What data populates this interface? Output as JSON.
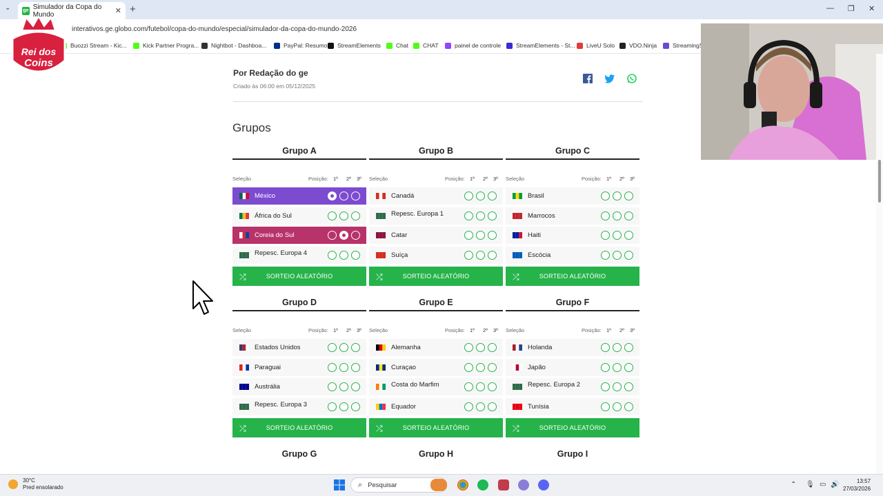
{
  "browser": {
    "tab_title": "Simulador da Copa do Mundo",
    "url": "interativos.ge.globo.com/futebol/copa-do-mundo/especial/simulador-da-copa-do-mundo-2026",
    "bookmarks": [
      {
        "label": "Buozzi Stream - Kic...",
        "color": "#53fc18"
      },
      {
        "label": "Kick Partner Progra...",
        "color": "#53fc18"
      },
      {
        "label": "Nightbot - Dashboa...",
        "color": "#333333"
      },
      {
        "label": "PayPal: Resumo",
        "color": "#003087"
      },
      {
        "label": "StreamElements",
        "color": "#111111"
      },
      {
        "label": "Chat",
        "color": "#53fc18"
      },
      {
        "label": "CHAT",
        "color": "#53fc18"
      },
      {
        "label": "painel de controle",
        "color": "#9146ff"
      },
      {
        "label": "StreamElements - St...",
        "color": "#3a2bd6"
      },
      {
        "label": "LiveU Solo",
        "color": "#e23b3b"
      },
      {
        "label": "VDO.Ninja",
        "color": "#222222"
      },
      {
        "label": "StreamingS",
        "color": "#6a4bd0"
      }
    ]
  },
  "logo": {
    "line1": "Rei dos",
    "line2": "Coins"
  },
  "article": {
    "byline": "Por Redação do ge",
    "created": "Criado às 06:00 em 05/12/2025",
    "section_title": "Grupos"
  },
  "labels": {
    "selecao": "Seleção",
    "posicao": "Posição:",
    "p1": "1º",
    "p2": "2º",
    "p3": "3º",
    "random_button": "SORTEIO ALEATÓRIO"
  },
  "groups": [
    {
      "name": "Grupo A",
      "teams": [
        {
          "name": "México",
          "flag": [
            "#006847",
            "#ffffff",
            "#ce1126"
          ],
          "selected": 1,
          "style": "selA"
        },
        {
          "name": "África do Sul",
          "flag": [
            "#007749",
            "#ffb81c",
            "#de3831"
          ],
          "selected": 0,
          "style": ""
        },
        {
          "name": "Coreia do Sul",
          "flag": [
            "#ffffff",
            "#cd2e3a",
            "#0047a0"
          ],
          "selected": 2,
          "style": "selB"
        },
        {
          "name": "Repesc. Europa 4",
          "flag": [
            "#2e6b4a",
            "#2e6b4a",
            "#2e6b4a"
          ],
          "selected": 0,
          "style": ""
        }
      ]
    },
    {
      "name": "Grupo B",
      "teams": [
        {
          "name": "Canadá",
          "flag": [
            "#d52b1e",
            "#ffffff",
            "#d52b1e"
          ],
          "selected": 0,
          "style": ""
        },
        {
          "name": "Repesc. Europa 1",
          "flag": [
            "#2e6b4a",
            "#2e6b4a",
            "#2e6b4a"
          ],
          "selected": 0,
          "style": ""
        },
        {
          "name": "Catar",
          "flag": [
            "#8a1538",
            "#8a1538",
            "#8a1538"
          ],
          "selected": 0,
          "style": ""
        },
        {
          "name": "Suíça",
          "flag": [
            "#d52b1e",
            "#d52b1e",
            "#d52b1e"
          ],
          "selected": 0,
          "style": ""
        }
      ]
    },
    {
      "name": "Grupo C",
      "teams": [
        {
          "name": "Brasil",
          "flag": [
            "#009c3b",
            "#ffdf00",
            "#009c3b"
          ],
          "selected": 0,
          "style": ""
        },
        {
          "name": "Marrocos",
          "flag": [
            "#c1272d",
            "#c1272d",
            "#c1272d"
          ],
          "selected": 0,
          "style": ""
        },
        {
          "name": "Haiti",
          "flag": [
            "#00209f",
            "#00209f",
            "#d21034"
          ],
          "selected": 0,
          "style": ""
        },
        {
          "name": "Escócia",
          "flag": [
            "#005eb8",
            "#005eb8",
            "#005eb8"
          ],
          "selected": 0,
          "style": ""
        }
      ]
    },
    {
      "name": "Grupo D",
      "teams": [
        {
          "name": "Estados Unidos",
          "flag": [
            "#3c3b6e",
            "#b22234",
            "#ffffff"
          ],
          "selected": 0,
          "style": ""
        },
        {
          "name": "Paraguai",
          "flag": [
            "#d52b1e",
            "#ffffff",
            "#0038a8"
          ],
          "selected": 0,
          "style": ""
        },
        {
          "name": "Austrália",
          "flag": [
            "#00008b",
            "#00008b",
            "#00008b"
          ],
          "selected": 0,
          "style": ""
        },
        {
          "name": "Repesc. Europa 3",
          "flag": [
            "#2e6b4a",
            "#2e6b4a",
            "#2e6b4a"
          ],
          "selected": 0,
          "style": ""
        }
      ]
    },
    {
      "name": "Grupo E",
      "teams": [
        {
          "name": "Alemanha",
          "flag": [
            "#000000",
            "#dd0000",
            "#ffce00"
          ],
          "selected": 0,
          "style": ""
        },
        {
          "name": "Curaçao",
          "flag": [
            "#002b7f",
            "#f9e814",
            "#002b7f"
          ],
          "selected": 0,
          "style": ""
        },
        {
          "name": "Costa do Marfim",
          "flag": [
            "#f77f00",
            "#ffffff",
            "#009e60"
          ],
          "selected": 0,
          "style": ""
        },
        {
          "name": "Equador",
          "flag": [
            "#ffd100",
            "#0072ce",
            "#ef3340"
          ],
          "selected": 0,
          "style": ""
        }
      ]
    },
    {
      "name": "Grupo F",
      "teams": [
        {
          "name": "Holanda",
          "flag": [
            "#ae1c28",
            "#ffffff",
            "#21468b"
          ],
          "selected": 0,
          "style": ""
        },
        {
          "name": "Japão",
          "flag": [
            "#ffffff",
            "#bc002d",
            "#ffffff"
          ],
          "selected": 0,
          "style": ""
        },
        {
          "name": "Repesc. Europa 2",
          "flag": [
            "#2e6b4a",
            "#2e6b4a",
            "#2e6b4a"
          ],
          "selected": 0,
          "style": ""
        },
        {
          "name": "Tunísia",
          "flag": [
            "#e70013",
            "#e70013",
            "#e70013"
          ],
          "selected": 0,
          "style": ""
        }
      ]
    }
  ],
  "next_groups": [
    "Grupo G",
    "Grupo H",
    "Grupo I"
  ],
  "taskbar": {
    "temp": "30°C",
    "weather": "Pred ensolarado",
    "search": "Pesquisar",
    "time": "13:57",
    "date": "27/03/2026"
  }
}
